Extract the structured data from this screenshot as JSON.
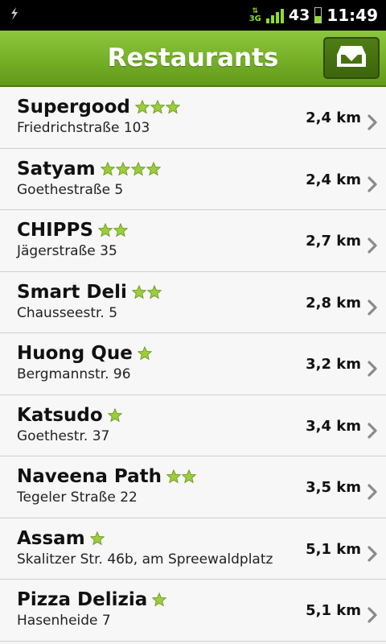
{
  "status_bar": {
    "network_type": "3G",
    "battery_percent": "43",
    "battery_level": 0.43,
    "time": "11:49",
    "icons": [
      "usb-debug-icon",
      "data-arrows-icon",
      "signal-icon",
      "battery-icon"
    ]
  },
  "header": {
    "title": "Restaurants",
    "action_icon": "archive-download-icon"
  },
  "colors": {
    "header_green": "#77b229",
    "star_green": "#9ccd3c",
    "network_green": "#8fdc2a"
  },
  "restaurants": [
    {
      "name": "Supergood",
      "stars": 3,
      "address": "Friedrichstraße 103",
      "distance": "2,4 km"
    },
    {
      "name": "Satyam",
      "stars": 4,
      "address": "Goethestraße 5",
      "distance": "2,4 km"
    },
    {
      "name": "CHIPPS",
      "stars": 2,
      "address": "Jägerstraße 35",
      "distance": "2,7 km"
    },
    {
      "name": "Smart Deli",
      "stars": 2,
      "address": "Chausseestr. 5",
      "distance": "2,8 km"
    },
    {
      "name": "Huong Que",
      "stars": 1,
      "address": "Bergmannstr. 96",
      "distance": "3,2 km"
    },
    {
      "name": "Katsudo",
      "stars": 1,
      "address": "Goethestr. 37",
      "distance": "3,4 km"
    },
    {
      "name": "Naveena Path",
      "stars": 2,
      "address": "Tegeler Straße 22",
      "distance": "3,5 km"
    },
    {
      "name": "Assam",
      "stars": 1,
      "address": "Skalitzer Str. 46b, am Spreewaldplatz",
      "distance": "5,1 km"
    },
    {
      "name": "Pizza Delizia",
      "stars": 1,
      "address": "Hasenheide 7",
      "distance": "5,1 km"
    }
  ]
}
